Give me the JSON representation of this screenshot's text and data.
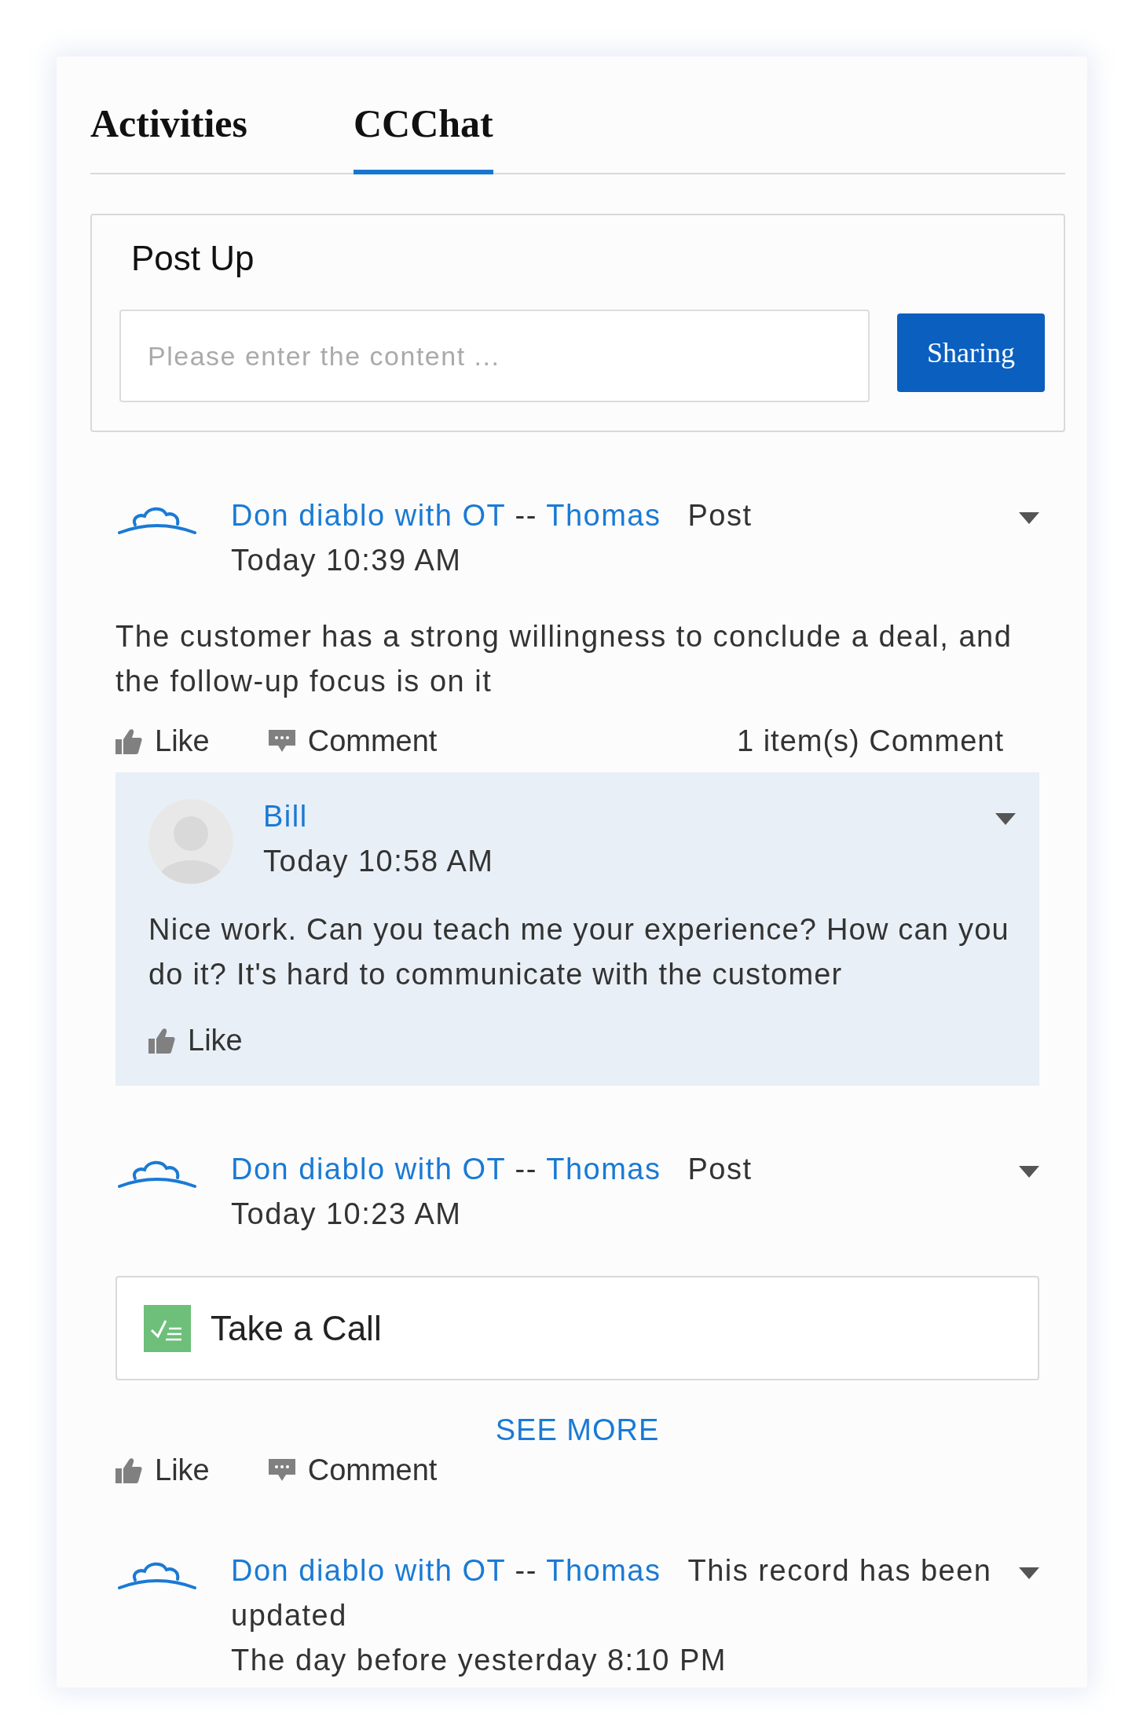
{
  "tabs": [
    {
      "label": "Activities",
      "selected": false
    },
    {
      "label": "CCChat",
      "selected": true
    }
  ],
  "composer": {
    "title": "Post Up",
    "placeholder": "Please enter the content ...",
    "button": "Sharing"
  },
  "posts": [
    {
      "company": "Don diablo with OT",
      "separator": "--",
      "person": "Thomas",
      "action": "Post",
      "time": "Today 10:39 AM",
      "body": "The customer has a strong willingness to conclude a deal, and the follow-up focus is on it",
      "actions": [
        {
          "kind": "like",
          "label": "Like"
        },
        {
          "kind": "comment",
          "label": "Comment"
        }
      ],
      "comment_count": "1  item(s) Comment",
      "comments": [
        {
          "name": "Bill",
          "time": "Today 10:58 AM",
          "body": "Nice work. Can you teach me your experience? How can you do it? It's hard to communicate with the customer",
          "actions": [
            {
              "kind": "like",
              "label": "Like"
            }
          ]
        }
      ]
    },
    {
      "company": "Don diablo with OT",
      "separator": "--",
      "person": "Thomas",
      "action": "Post",
      "time": "Today 10:23 AM",
      "attachment": {
        "label": "Take a Call"
      },
      "see_more": "SEE MORE",
      "actions": [
        {
          "kind": "like",
          "label": "Like"
        },
        {
          "kind": "comment",
          "label": "Comment"
        }
      ]
    },
    {
      "company": "Don diablo with OT",
      "separator": "--",
      "person": "Thomas",
      "action": "This record has been updated",
      "time": "The day before yesterday 8:10 PM"
    }
  ]
}
